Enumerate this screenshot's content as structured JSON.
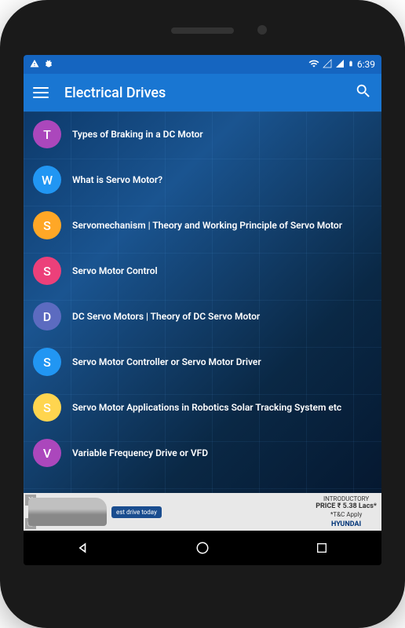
{
  "status": {
    "time": "6:39"
  },
  "header": {
    "title": "Electrical Drives"
  },
  "list": {
    "items": [
      {
        "letter": "T",
        "color": "#ab47bc",
        "title": "Types of Braking in a DC Motor"
      },
      {
        "letter": "W",
        "color": "#2196f3",
        "title": "What is Servo Motor?"
      },
      {
        "letter": "S",
        "color": "#ffa726",
        "title": "Servomechanism | Theory and Working Principle of Servo Motor"
      },
      {
        "letter": "S",
        "color": "#ec407a",
        "title": "Servo Motor Control"
      },
      {
        "letter": "D",
        "color": "#5c6bc0",
        "title": "DC Servo Motors | Theory of DC Servo Motor"
      },
      {
        "letter": "S",
        "color": "#2196f3",
        "title": "Servo Motor Controller or Servo Motor Driver"
      },
      {
        "letter": "S",
        "color": "#ffd54f",
        "title": "Servo Motor Applications in Robotics Solar Tracking System etc"
      },
      {
        "letter": "V",
        "color": "#ab47bc",
        "title": "Variable Frequency Drive or VFD"
      }
    ]
  },
  "ad": {
    "drive_label": "est drive today",
    "intro": "INTRODUCTORY",
    "price": "PRICE ₹ 5.38 Lacs*",
    "tc": "*T&C Apply",
    "brand": "HYUNDAI"
  }
}
